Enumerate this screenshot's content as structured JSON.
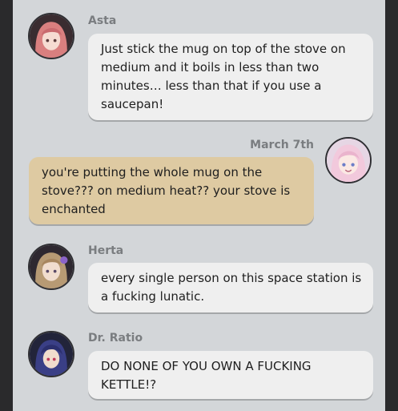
{
  "messages": [
    {
      "sender": "Asta",
      "side": "left",
      "text": "Just stick the mug on top of the stove on medium and it boils in less than two minutes… less than that if you use a saucepan!"
    },
    {
      "sender": "March 7th",
      "side": "right",
      "text": "you're putting the whole mug on the stove??? on medium heat?? your stove is enchanted"
    },
    {
      "sender": "Herta",
      "side": "left",
      "text": "every single person on this space station is a fucking lunatic."
    },
    {
      "sender": "Dr. Ratio",
      "side": "left",
      "text": "DO NONE OF YOU OWN A FUCKING KETTLE!?"
    }
  ],
  "colors": {
    "panel_bg": "#d3d6d9",
    "bubble_default": "#efefef",
    "bubble_self": "#decaa2",
    "name_text": "#7a7d80"
  }
}
